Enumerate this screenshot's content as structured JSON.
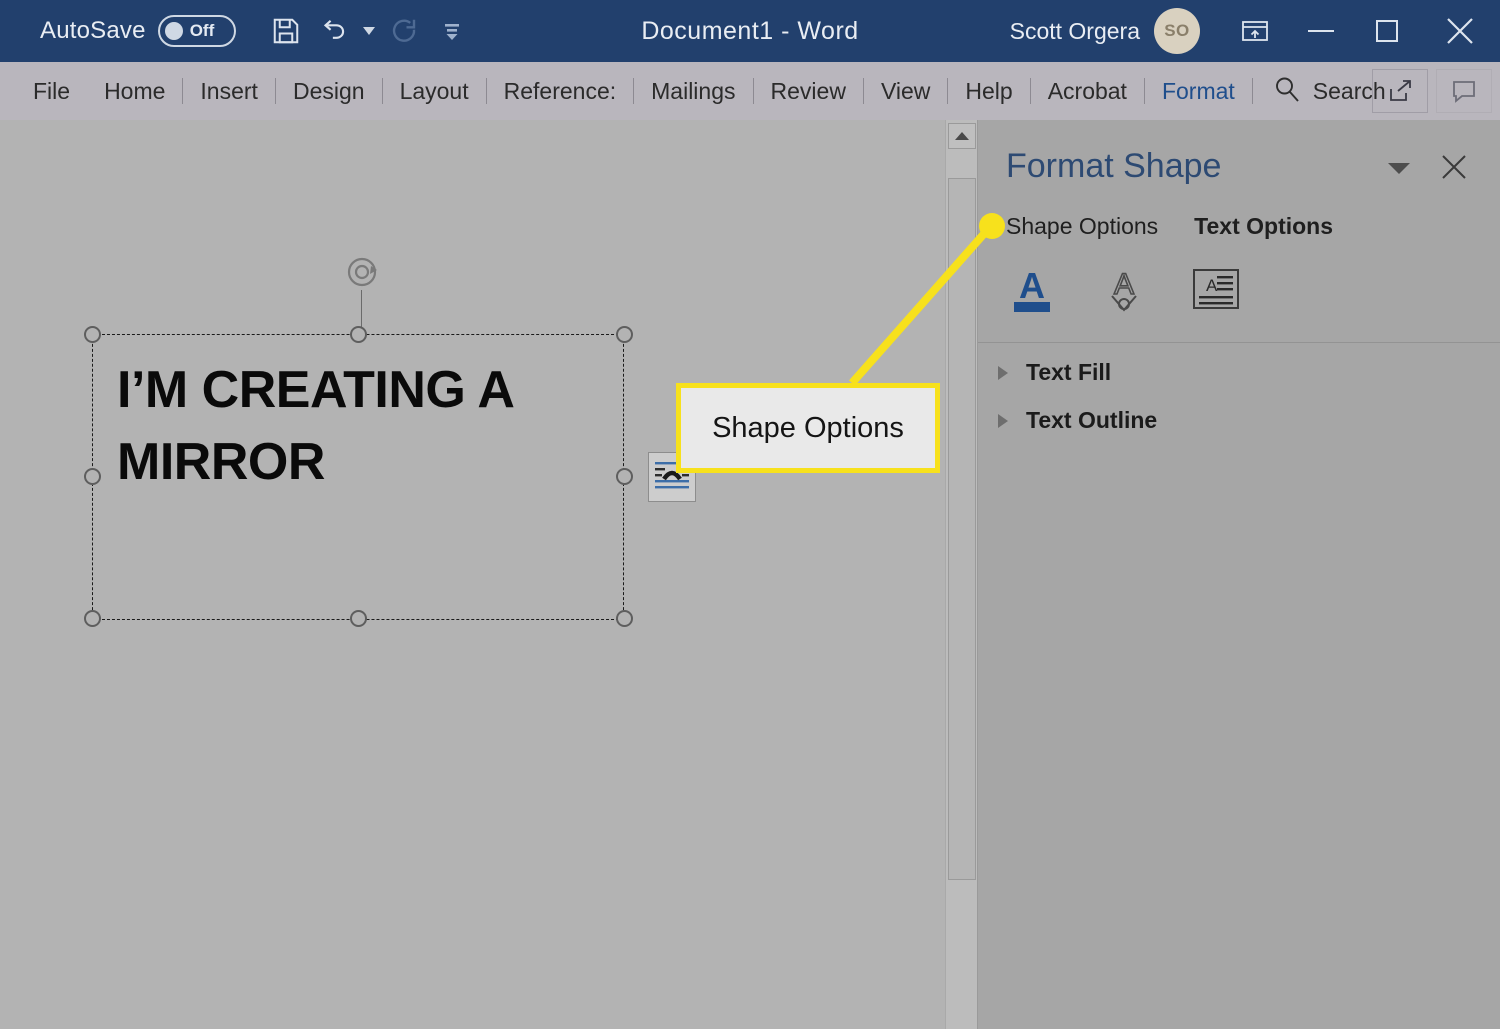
{
  "titlebar": {
    "autosave_label": "AutoSave",
    "autosave_state": "Off",
    "save_icon": "save-icon",
    "undo_icon": "undo-icon",
    "redo_icon": "redo-icon",
    "customize_qat_icon": "customize-quick-access-toolbar-icon",
    "document_title": "Document1  -  Word",
    "user_name": "Scott Orgera",
    "avatar_initials": "SO",
    "ribbon_display_icon": "ribbon-display-options-icon",
    "minimize_icon": "minimize-icon",
    "maximize_icon": "maximize-icon",
    "close_icon": "close-icon",
    "background_color": "#22406d"
  },
  "ribbon": {
    "tabs": [
      {
        "label": "File"
      },
      {
        "label": "Home"
      },
      {
        "label": "Insert"
      },
      {
        "label": "Design"
      },
      {
        "label": "Layout"
      },
      {
        "label": "Reference:"
      },
      {
        "label": "Mailings"
      },
      {
        "label": "Review"
      },
      {
        "label": "View"
      },
      {
        "label": "Help"
      },
      {
        "label": "Acrobat"
      },
      {
        "label": "Format"
      }
    ],
    "active_tab": "Format",
    "active_tab_color": "#1f4e8c",
    "search": {
      "icon": "search-icon",
      "label": "Search"
    },
    "share_icon": "share-icon",
    "comments_icon": "comments-icon",
    "background_color": "#b9b6bd"
  },
  "document": {
    "background_color": "#b3b3b3",
    "textbox": {
      "text": "I’M CREATING A MIRROR",
      "rotate_handle_icon": "rotate-handle-icon",
      "handles": [
        "top-left",
        "top-center",
        "top-right",
        "middle-left",
        "middle-right",
        "bottom-left",
        "bottom-center",
        "bottom-right"
      ]
    },
    "layout_options_icon": "layout-options-icon"
  },
  "scrollbar": {
    "up_arrow_icon": "scroll-up-arrow-icon",
    "thumb": "vertical-scroll-thumb"
  },
  "format_pane": {
    "title": "Format Shape",
    "dropdown_icon": "pane-dropdown-icon",
    "close_icon": "pane-close-icon",
    "tabs": [
      {
        "label": "Shape Options",
        "selected": false
      },
      {
        "label": "Text Options",
        "selected": true
      }
    ],
    "icon_row": [
      {
        "name": "text-fill-and-outline-icon",
        "active": true
      },
      {
        "name": "text-effects-icon",
        "active": false
      },
      {
        "name": "textbox-layout-icon",
        "active": false
      }
    ],
    "sections": [
      {
        "label": "Text Fill",
        "expanded": false
      },
      {
        "label": "Text Outline",
        "expanded": false
      }
    ],
    "background_color": "#a6a6a6",
    "title_color": "#2d4a73",
    "accent_color": "#1f4e8c"
  },
  "annotation": {
    "callout_label": "Shape Options",
    "highlight_color": "#f7e11c",
    "callout_fill": "#e9e9e9",
    "dot_target": "shape-options-tab"
  }
}
